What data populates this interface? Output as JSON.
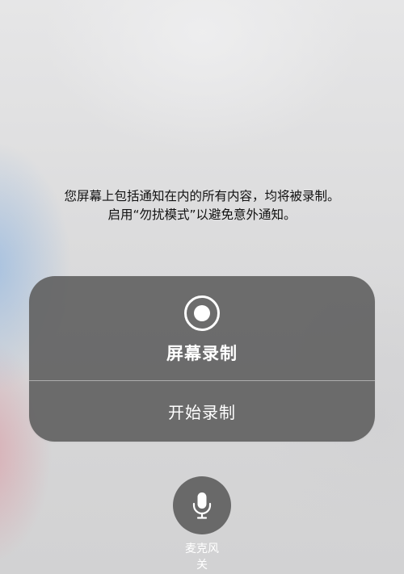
{
  "notice": {
    "line1": "您屏幕上包括通知在内的所有内容，均将被录制。",
    "line2": "启用“勿扰模式”以避免意外通知。"
  },
  "panel": {
    "icon": "screen-record-icon",
    "title": "屏幕录制",
    "start_label": "开始录制"
  },
  "microphone": {
    "icon": "microphone-icon",
    "label_line1": "麦克风",
    "label_line2": "关"
  },
  "colors": {
    "panel_bg": "#5f5f5f",
    "text_light": "#ffffff",
    "text_dark": "#111111"
  }
}
